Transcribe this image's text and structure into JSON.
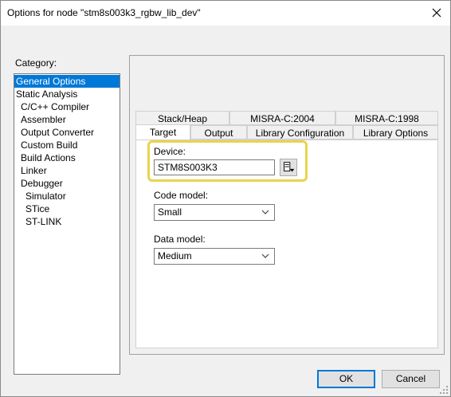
{
  "window": {
    "title": "Options for node \"stm8s003k3_rgbw_lib_dev\""
  },
  "category": {
    "label": "Category:",
    "items": [
      {
        "label": "General Options",
        "indent": 0,
        "selected": true
      },
      {
        "label": "Static Analysis",
        "indent": 0
      },
      {
        "label": "C/C++ Compiler",
        "indent": 1
      },
      {
        "label": "Assembler",
        "indent": 1
      },
      {
        "label": "Output Converter",
        "indent": 1
      },
      {
        "label": "Custom Build",
        "indent": 1
      },
      {
        "label": "Build Actions",
        "indent": 1
      },
      {
        "label": "Linker",
        "indent": 1
      },
      {
        "label": "Debugger",
        "indent": 1
      },
      {
        "label": "Simulator",
        "indent": 2
      },
      {
        "label": "STice",
        "indent": 2
      },
      {
        "label": "ST-LINK",
        "indent": 2
      }
    ]
  },
  "tabs": {
    "back_row": [
      "Stack/Heap",
      "MISRA-C:2004",
      "MISRA-C:1998"
    ],
    "front_row": [
      "Target",
      "Output",
      "Library Configuration",
      "Library Options"
    ],
    "active": "Target"
  },
  "target": {
    "device_label": "Device:",
    "device_value": "STM8S003K3",
    "code_model_label": "Code model:",
    "code_model_value": "Small",
    "data_model_label": "Data model:",
    "data_model_value": "Medium"
  },
  "buttons": {
    "ok": "OK",
    "cancel": "Cancel"
  },
  "colors": {
    "selection": "#0078d7",
    "highlight": "#e8d44d"
  },
  "icons": [
    "close-icon",
    "device-select-icon",
    "chevron-down-icon",
    "resize-grip-icon"
  ]
}
